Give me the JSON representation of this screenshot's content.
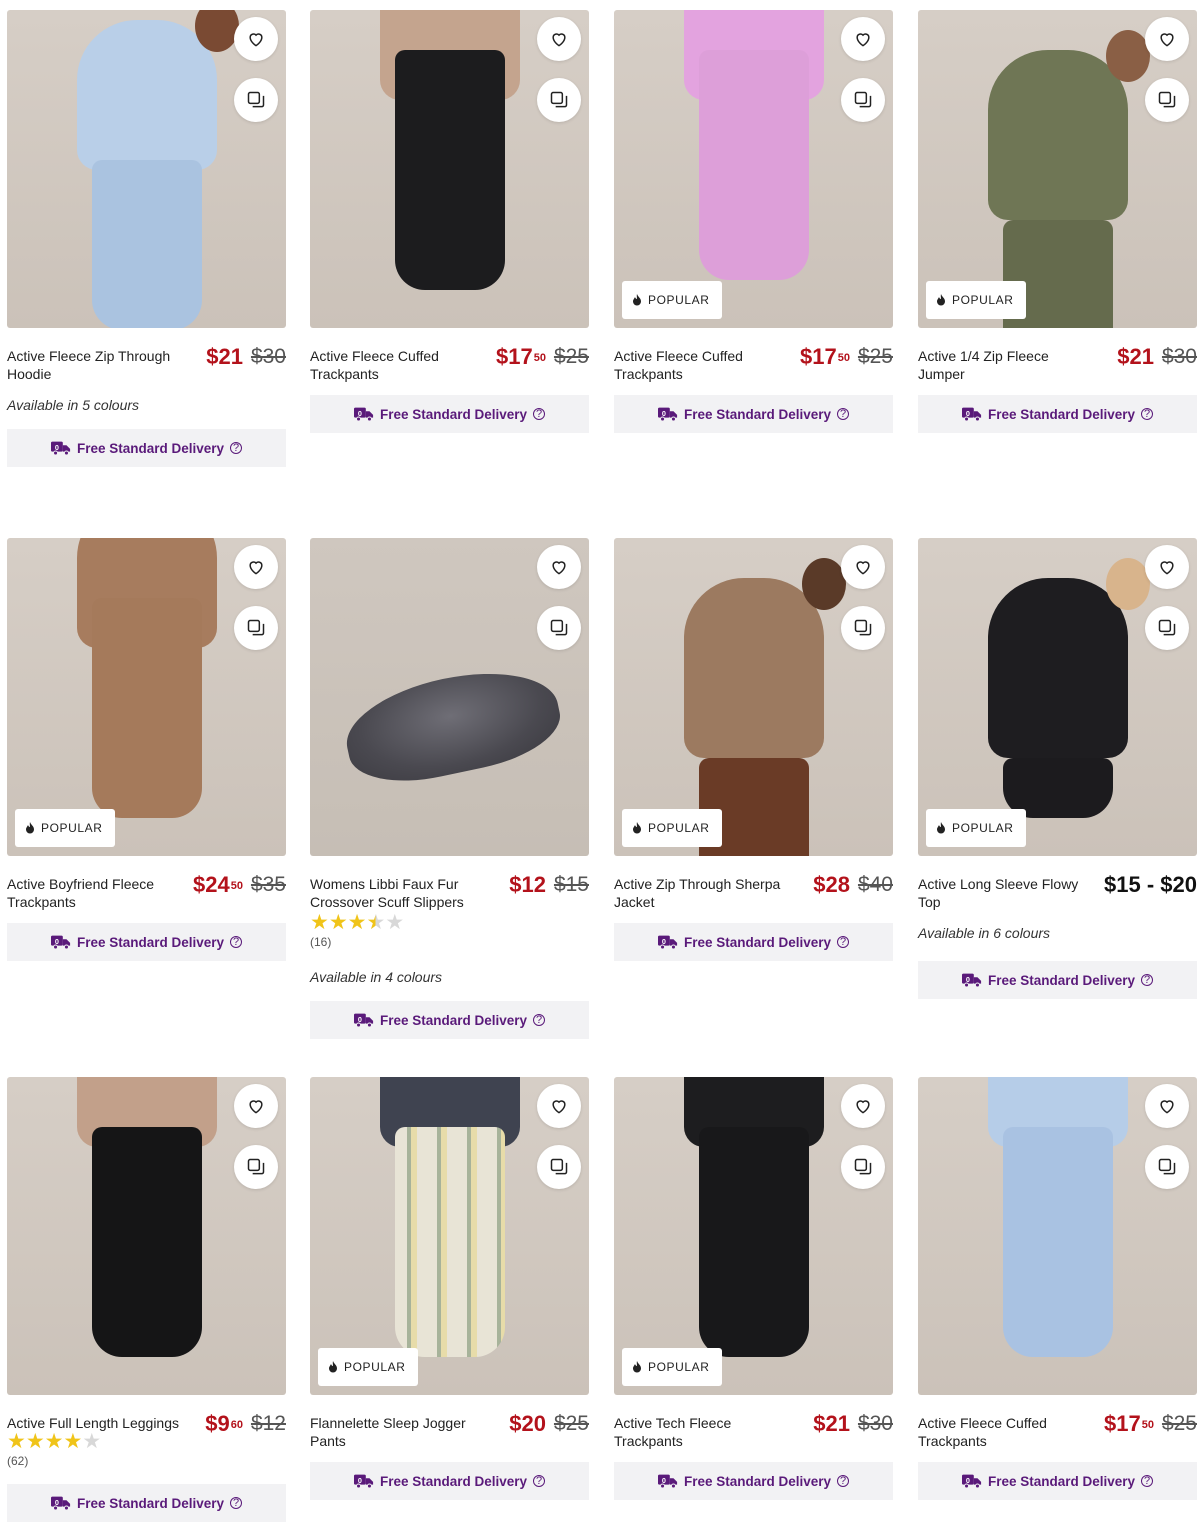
{
  "common": {
    "delivery_label": "Free Standard Delivery",
    "popular_label": "POPULAR",
    "favourite_icon": "heart-outline-icon",
    "compare_icon": "compare-copy-icon",
    "delivery_icon": "delivery-truck-icon",
    "brand_color": "#5a1a7a",
    "sale_color": "#b3121b"
  },
  "products": [
    {
      "name": "Active Fleece Zip Through Hoodie",
      "price_main": "$21",
      "price_cents": "",
      "was": "$30",
      "colours": "Available in 5 colours",
      "popular": false
    },
    {
      "name": "Active Fleece Cuffed Trackpants",
      "price_main": "$17",
      "price_cents": "50",
      "was": "$25",
      "popular": false
    },
    {
      "name": "Active Fleece Cuffed Trackpants",
      "price_main": "$17",
      "price_cents": "50",
      "was": "$25",
      "popular": true
    },
    {
      "name": "Active 1/4 Zip Fleece Jumper",
      "price_main": "$21",
      "price_cents": "",
      "was": "$30",
      "popular": true
    },
    {
      "name": "Active Boyfriend Fleece Trackpants",
      "price_main": "$24",
      "price_cents": "50",
      "was": "$35",
      "popular": true
    },
    {
      "name": "Womens Libbi Faux Fur Crossover Scuff Slippers",
      "price_main": "$12",
      "price_cents": "",
      "was": "$15",
      "rating": 3.5,
      "reviews": "(16)",
      "colours": "Available in 4 colours",
      "popular": false
    },
    {
      "name": "Active Zip Through Sherpa Jacket",
      "price_main": "$28",
      "price_cents": "",
      "was": "$40",
      "popular": true
    },
    {
      "name": "Active Long Sleeve Flowy Top",
      "price_main": "$15 - $20",
      "price_cents": "",
      "was": "",
      "colours": "Available in 6 colours",
      "popular": true
    },
    {
      "name": "Active Full Length Leggings",
      "price_main": "$9",
      "price_cents": "60",
      "was": "$12",
      "rating": 4,
      "reviews": "(62)",
      "popular": false
    },
    {
      "name": "Flannelette Sleep Jogger Pants",
      "price_main": "$20",
      "price_cents": "",
      "was": "$25",
      "popular": true
    },
    {
      "name": "Active Tech Fleece Trackpants",
      "price_main": "$21",
      "price_cents": "",
      "was": "$30",
      "popular": true
    },
    {
      "name": "Active Fleece Cuffed Trackpants",
      "price_main": "$17",
      "price_cents": "50",
      "was": "$25",
      "popular": false
    }
  ]
}
